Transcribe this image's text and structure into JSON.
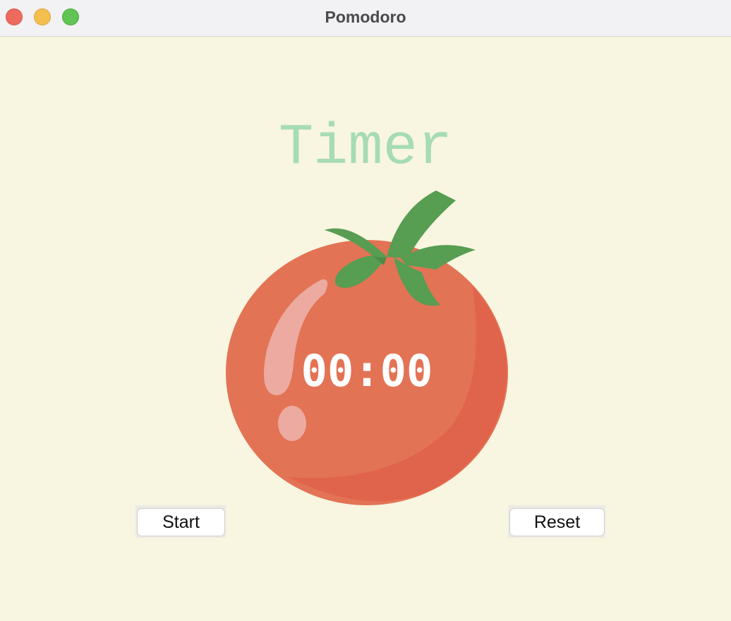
{
  "window": {
    "title": "Pomodoro"
  },
  "main": {
    "heading": "Timer",
    "time": "00:00",
    "start_label": "Start",
    "reset_label": "Reset"
  },
  "colors": {
    "background": "#f8f5e0",
    "heading": "#a6dcb3",
    "tomato": "#e37355",
    "leaves": "#579d52",
    "time_text": "#ffffff"
  },
  "icons": {
    "tomato": "tomato-image"
  }
}
